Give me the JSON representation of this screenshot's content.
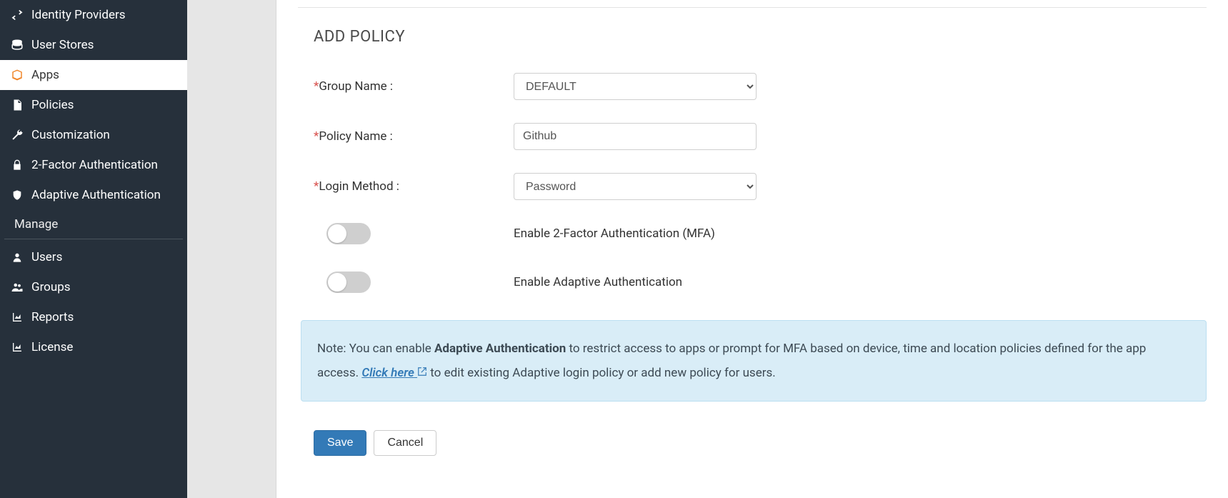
{
  "sidebar": {
    "items": [
      {
        "label": "Identity Providers",
        "icon": "swap"
      },
      {
        "label": "User Stores",
        "icon": "database"
      },
      {
        "label": "Apps",
        "icon": "box",
        "active": true
      },
      {
        "label": "Policies",
        "icon": "document"
      },
      {
        "label": "Customization",
        "icon": "wrench"
      },
      {
        "label": "2-Factor Authentication",
        "icon": "lock"
      },
      {
        "label": "Adaptive Authentication",
        "icon": "shield"
      }
    ],
    "section": "Manage",
    "manage_items": [
      {
        "label": "Users",
        "icon": "user"
      },
      {
        "label": "Groups",
        "icon": "users"
      },
      {
        "label": "Reports",
        "icon": "chart"
      },
      {
        "label": "License",
        "icon": "chart"
      }
    ]
  },
  "main": {
    "heading": "ADD POLICY",
    "fields": {
      "group_name": {
        "label": "Group Name :",
        "value": "DEFAULT"
      },
      "policy_name": {
        "label": "Policy Name :",
        "value": "Github"
      },
      "login_method": {
        "label": "Login Method :",
        "value": "Password"
      }
    },
    "toggles": {
      "mfa": "Enable 2-Factor Authentication (MFA)",
      "adaptive": "Enable Adaptive Authentication"
    },
    "note": {
      "prefix": "Note: You can enable ",
      "strong": "Adaptive Authentication",
      "mid": " to restrict access to apps or prompt for MFA based on device, time and location policies defined for the app access. ",
      "link": "Click here",
      "suffix": " to edit existing Adaptive login policy or add new policy for users."
    },
    "actions": {
      "save": "Save",
      "cancel": "Cancel"
    }
  }
}
